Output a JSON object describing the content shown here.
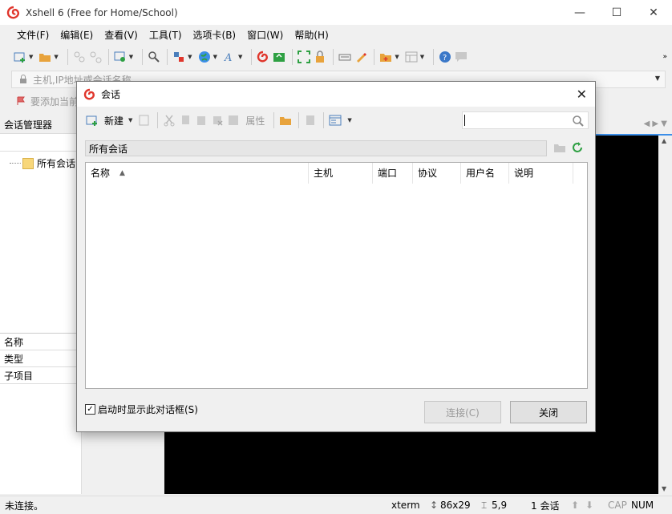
{
  "window": {
    "title": "Xshell 6 (Free for Home/School)",
    "minimize": "—",
    "maximize": "☐",
    "close": "✕"
  },
  "menu": [
    "文件(F)",
    "编辑(E)",
    "查看(V)",
    "工具(T)",
    "选项卡(B)",
    "窗口(W)",
    "帮助(H)"
  ],
  "address": {
    "placeholder": "主机,IP地址或会话名称"
  },
  "linkbar": {
    "text": "要添加当前"
  },
  "session_panel": {
    "title": "会话管理器",
    "tree_item": "所有会话",
    "props": [
      "名称",
      "类型",
      "子项目"
    ]
  },
  "dialog": {
    "title": "会话",
    "new_label": "新建",
    "props_label": "属性",
    "path": "所有会话",
    "columns": [
      "名称",
      "主机",
      "端口",
      "协议",
      "用户名",
      "说明"
    ],
    "sort_arrow": "▲",
    "checkbox_checked": "✓",
    "checkbox_label": "启动时显示此对话框(S)",
    "connect_button": "连接(C)",
    "close_button": "关闭"
  },
  "status": {
    "connection": "未连接。",
    "terminal": "xterm",
    "size": "86x29",
    "position": "5,9",
    "sessions": "1 会话",
    "cap": "CAP",
    "num": "NUM"
  },
  "colors": {
    "accent": "#3b8ee8",
    "logo": "#e0362c",
    "green": "#2ea043",
    "terminal_bg": "#000000"
  }
}
